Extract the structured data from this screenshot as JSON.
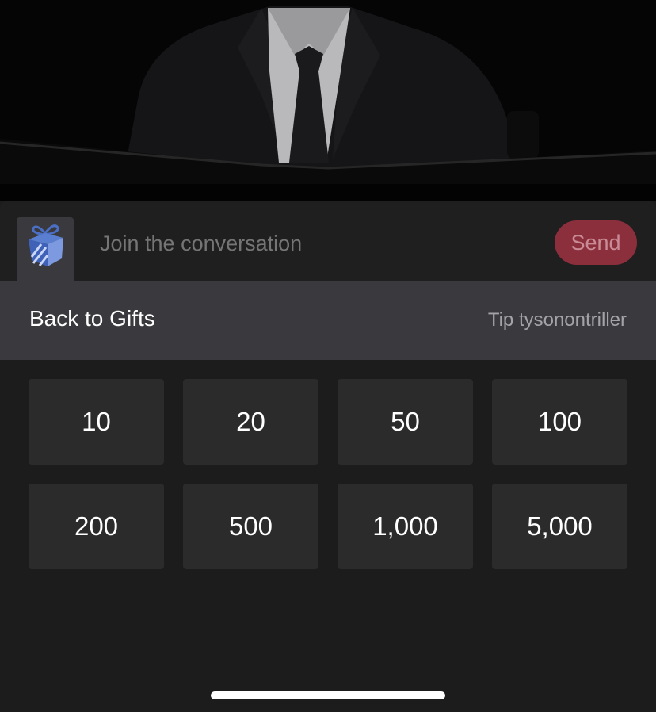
{
  "chat": {
    "placeholder": "Join the conversation",
    "send_label": "Send",
    "gift_icon": "gift-box-icon"
  },
  "tip_header": {
    "back_label": "Back to Gifts",
    "tip_label": "Tip tysonontriller"
  },
  "amounts": [
    "10",
    "20",
    "50",
    "100",
    "200",
    "500",
    "1,000",
    "5,000"
  ],
  "colors": {
    "send_bg": "#8c2f3c",
    "send_text": "#c98b95",
    "header_bg": "#3a3a3e",
    "tile_bg": "#2b2b2b",
    "sheet_bg": "#1c1c1c"
  }
}
